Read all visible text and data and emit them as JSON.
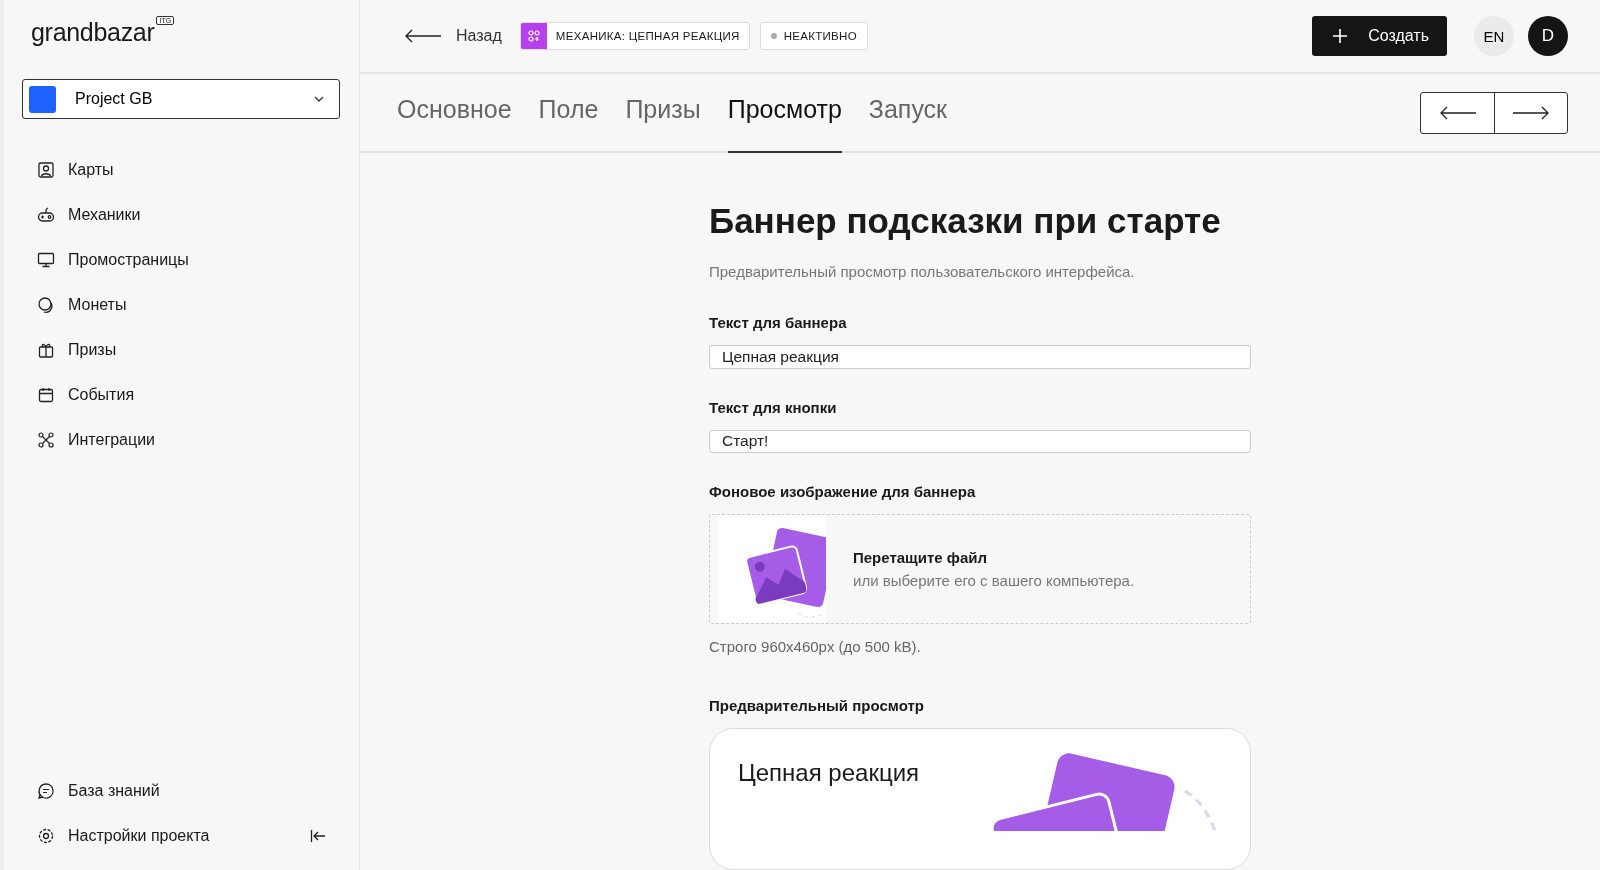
{
  "logo": {
    "name": "grandbazar",
    "badge": "ITG"
  },
  "project_select": {
    "value": "Project GB"
  },
  "sidebar": {
    "items": [
      {
        "label": "Карты"
      },
      {
        "label": "Механики"
      },
      {
        "label": "Промостраницы"
      },
      {
        "label": "Монеты"
      },
      {
        "label": "Призы"
      },
      {
        "label": "События"
      },
      {
        "label": "Интеграции"
      }
    ],
    "bottom_items": [
      {
        "label": "База знаний"
      },
      {
        "label": "Настройки проекта"
      }
    ]
  },
  "header": {
    "back": "Назад",
    "mechanic_tag": "МЕХАНИКА: ЦЕПНАЯ РЕАКЦИЯ",
    "status": "НЕАКТИВНО",
    "create_button": "Создать",
    "language": "EN",
    "avatar": "D"
  },
  "tabs": [
    {
      "label": "Основное",
      "selected": false
    },
    {
      "label": "Поле",
      "selected": false
    },
    {
      "label": "Призы",
      "selected": false
    },
    {
      "label": "Просмотр",
      "selected": true
    },
    {
      "label": "Запуск",
      "selected": false
    }
  ],
  "form": {
    "title": "Баннер подсказки при старте",
    "subtitle": "Предварительный просмотр пользовательского интерфейса.",
    "fields": [
      {
        "label": "Текст для баннера",
        "value": "Цепная реакция"
      },
      {
        "label": "Текст для кнопки",
        "value": "Старт!"
      }
    ],
    "upload": {
      "label": "Фоновое изображение для баннера",
      "title": "Перетащите файл",
      "hint": "или выберите его с вашего компьютера.",
      "note": "Строго 960x460px (до 500 kB)."
    },
    "preview": {
      "label": "Предварительный просмотр",
      "banner_text": "Цепная реакция"
    }
  }
}
